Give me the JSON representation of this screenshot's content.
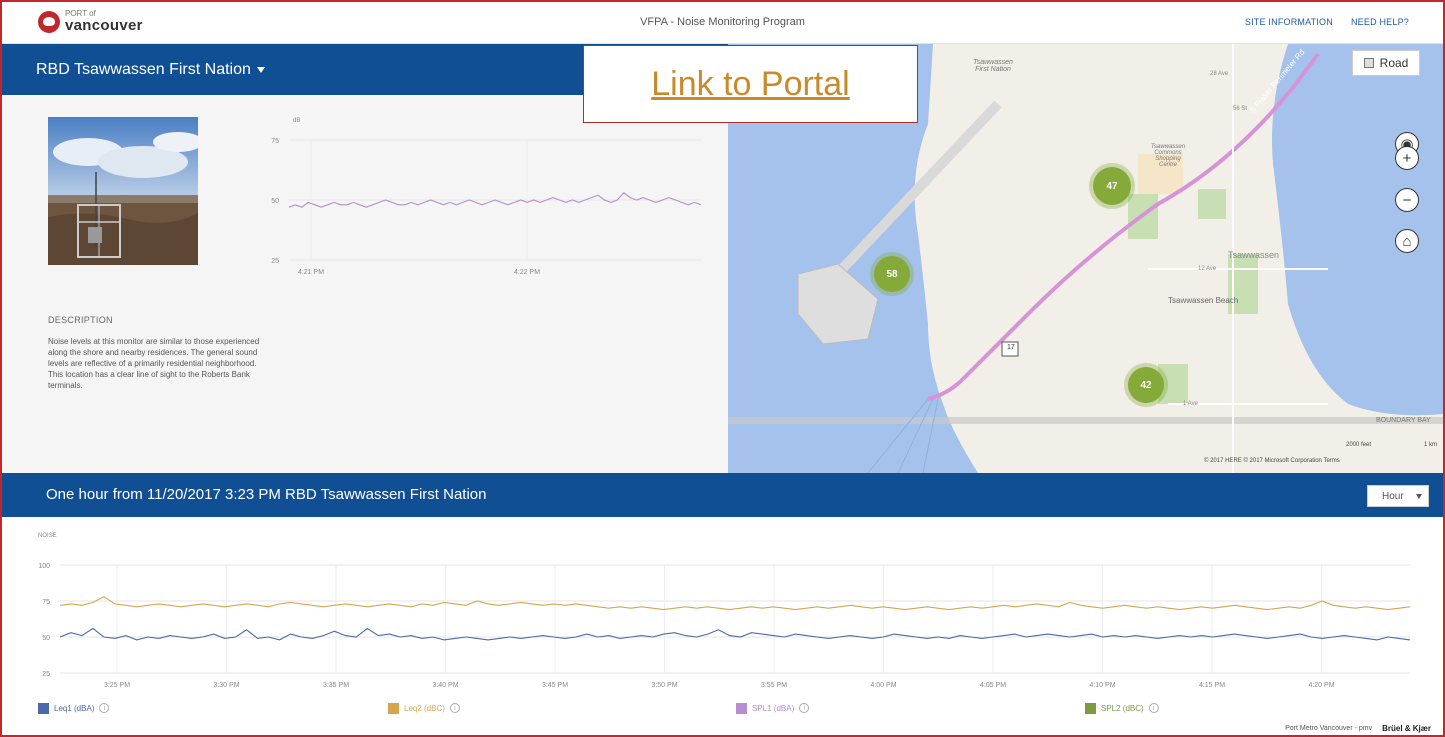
{
  "header": {
    "logo_small": "PORT of",
    "logo_big": "vancouver",
    "title": "VFPA - Noise Monitoring Program",
    "links": [
      "SITE INFORMATION",
      "NEED HELP?"
    ]
  },
  "station": {
    "name": "RBD Tsawwassen First Nation",
    "description_title": "DESCRIPTION",
    "description": "Noise levels at this monitor are similar to those experienced along the shore and nearby residences. The general sound levels are reflective of a primarily residential neighborhood. This location has a clear line of sight to the Roberts Bank terminals."
  },
  "link_box": {
    "label": "Link to Portal"
  },
  "map": {
    "road_label": "Road",
    "clusters": [
      {
        "label": "47",
        "tag": "cluster-47"
      },
      {
        "label": "58",
        "tag": "cluster-58"
      },
      {
        "label": "42",
        "tag": "cluster-42"
      }
    ],
    "place_labels": [
      "Tsawwassen First Nation",
      "Tsawwassen Commons Shopping Centre",
      "Tsawwassen",
      "Tsawwassen Beach",
      "28 Ave",
      "12 Ave",
      "1 Ave",
      "56 St",
      "S Fraser Perimeter Rd",
      "17",
      "BOUNDARY BAY"
    ],
    "scale_labels": [
      "2000 feet",
      "1 km"
    ],
    "copyright": "© 2017 HERE © 2017 Microsoft Corporation  Terms",
    "controls": [
      "locate-icon",
      "zoom-in-icon",
      "zoom-out-icon",
      "home-icon"
    ]
  },
  "range_bar": {
    "title": "One hour from 11/20/2017 3:23 PM RBD Tsawwassen First Nation",
    "select_value": "Hour"
  },
  "footer": {
    "credit": "Port Metro Vancouver - pmv",
    "brand": "Brüel & Kjær"
  },
  "chart_data": [
    {
      "type": "line",
      "ylabel": "dB",
      "ylim": [
        25,
        75
      ],
      "yticks": [
        25,
        50,
        75
      ],
      "xticks": [
        "4:21 PM",
        "4:22 PM"
      ],
      "grid": true,
      "series": [
        {
          "color": "#b58fd1",
          "values": [
            47,
            48,
            47,
            49,
            48,
            47,
            48,
            49,
            48,
            48,
            49,
            48,
            47,
            48,
            49,
            50,
            49,
            48,
            48,
            49,
            48,
            49,
            50,
            49,
            48,
            49,
            48,
            49,
            50,
            49,
            48,
            49,
            50,
            49,
            48,
            49,
            50,
            49,
            50,
            49,
            50,
            51,
            50,
            49,
            50,
            49,
            50,
            51,
            52,
            50,
            49,
            50,
            53,
            51,
            50,
            51,
            50,
            49,
            50,
            51,
            50,
            49,
            48,
            49,
            48
          ]
        }
      ]
    },
    {
      "type": "line",
      "ylabel": "NOISE",
      "ylim": [
        25,
        100
      ],
      "yticks": [
        25,
        50,
        75,
        100
      ],
      "xticks": [
        "3:25 PM",
        "3:30 PM",
        "3:35 PM",
        "3:40 PM",
        "3:45 PM",
        "3:50 PM",
        "3:55 PM",
        "4:00 PM",
        "4:05 PM",
        "4:10 PM",
        "4:15 PM",
        "4:20 PM"
      ],
      "grid": true,
      "legend_position": "bottom",
      "series": [
        {
          "name": "Leq1 (dBA)",
          "color": "#4a6aa8",
          "values": [
            50,
            53,
            51,
            56,
            50,
            49,
            51,
            48,
            50,
            49,
            51,
            50,
            49,
            50,
            52,
            49,
            50,
            55,
            49,
            50,
            48,
            52,
            50,
            49,
            51,
            54,
            51,
            50,
            56,
            51,
            52,
            50,
            51,
            49,
            50,
            48,
            49,
            50,
            49,
            48,
            49,
            50,
            49,
            50,
            51,
            50,
            49,
            50,
            52,
            50,
            51,
            49,
            50,
            51,
            50,
            52,
            53,
            51,
            50,
            52,
            55,
            51,
            50,
            53,
            52,
            51,
            50,
            52,
            51,
            50,
            49,
            50,
            51,
            50,
            49,
            50,
            52,
            51,
            50,
            49,
            50,
            49,
            51,
            50,
            49,
            50,
            51,
            52,
            50,
            51,
            52,
            51,
            50,
            51,
            52,
            50,
            51,
            50,
            51,
            50,
            49,
            50,
            51,
            50,
            51,
            50,
            51,
            52,
            51,
            50,
            49,
            50,
            51,
            52,
            50,
            49,
            50,
            51,
            50,
            49,
            48,
            50,
            49,
            48
          ]
        },
        {
          "name": "Leq2 (dBC)",
          "color": "#d6a551",
          "values": [
            72,
            73,
            72,
            74,
            78,
            73,
            72,
            71,
            72,
            73,
            72,
            71,
            72,
            73,
            72,
            71,
            72,
            73,
            72,
            71,
            73,
            74,
            73,
            72,
            71,
            72,
            73,
            72,
            71,
            72,
            73,
            72,
            71,
            73,
            72,
            74,
            73,
            72,
            75,
            73,
            72,
            73,
            74,
            73,
            72,
            73,
            72,
            73,
            72,
            71,
            70,
            71,
            70,
            71,
            70,
            69,
            70,
            71,
            70,
            71,
            70,
            69,
            70,
            71,
            70,
            71,
            70,
            69,
            70,
            71,
            70,
            71,
            72,
            71,
            70,
            71,
            70,
            69,
            70,
            71,
            70,
            69,
            70,
            71,
            70,
            71,
            72,
            71,
            72,
            73,
            72,
            71,
            74,
            72,
            71,
            70,
            71,
            72,
            71,
            70,
            71,
            70,
            69,
            70,
            71,
            70,
            71,
            72,
            71,
            70,
            69,
            70,
            71,
            70,
            72,
            75,
            72,
            71,
            70,
            71,
            70,
            69,
            70,
            71
          ]
        },
        {
          "name": "SPL1 (dBA)",
          "color": "#b58fd1",
          "values": []
        },
        {
          "name": "SPL2 (dBC)",
          "color": "#7c9a44",
          "values": []
        }
      ]
    }
  ]
}
